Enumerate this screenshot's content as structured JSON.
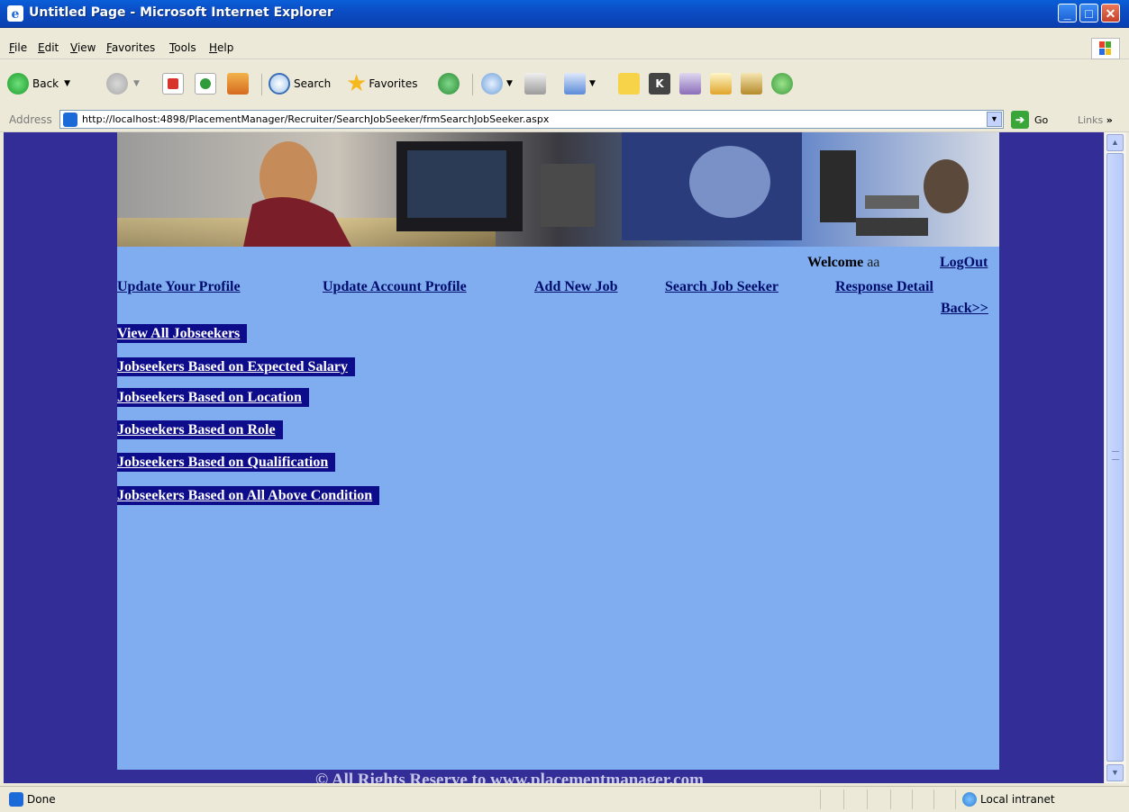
{
  "window": {
    "title": "Untitled Page - Microsoft Internet Explorer",
    "controls": {
      "minimize": "_",
      "maximize": "□",
      "close": "✕"
    }
  },
  "menu": [
    "File",
    "Edit",
    "View",
    "Favorites",
    "Tools",
    "Help"
  ],
  "toolbar": {
    "back_label": "Back",
    "search_label": "Search",
    "favorites_label": "Favorites"
  },
  "address": {
    "label": "Address",
    "url": "http://localhost:4898/PlacementManager/Recruiter/SearchJobSeeker/frmSearchJobSeeker.aspx",
    "go_label": "Go",
    "links_label": "Links",
    "links_chevron": "»"
  },
  "page": {
    "welcome_label": "Welcome",
    "username": "aa",
    "logout_label": "LogOut",
    "nav": [
      "Update Your Profile",
      "Update Account Profile",
      "Add New Job",
      "Search Job Seeker",
      "Response Detail"
    ],
    "back_label": "Back>>",
    "search_links": [
      "View All Jobseekers",
      "Jobseekers Based on Expected Salary",
      "Jobseekers Based on Location",
      "Jobseekers Based on Role",
      "Jobseekers Based on Qualification",
      "Jobseekers Based on All Above Condition"
    ],
    "footer": "© All Rights Reserve to www.placementmanager.com"
  },
  "status": {
    "text": "Done",
    "zone": "Local intranet"
  },
  "colors": {
    "page_bg": "#7fadf0",
    "outer_bg": "#332e97",
    "link_button_bg": "#0d0d8c",
    "nav_link": "#000c6b"
  }
}
